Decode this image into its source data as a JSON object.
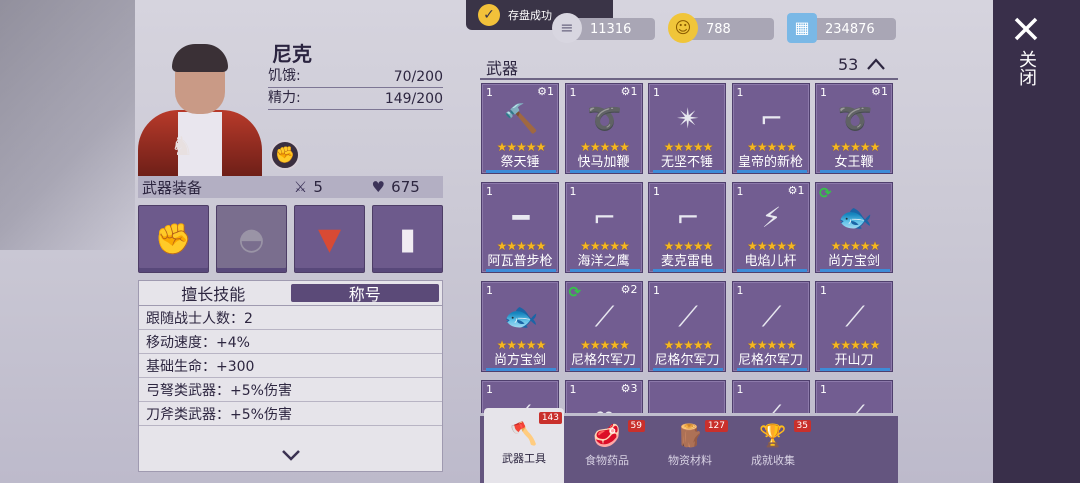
{
  "toast": {
    "text": "存盘成功"
  },
  "currencies": [
    {
      "icon": "coin-stack-icon",
      "value": "11316"
    },
    {
      "icon": "smiley-coin-icon",
      "value": "788"
    },
    {
      "icon": "map-ticket-icon",
      "value": "234876"
    }
  ],
  "character": {
    "name": "尼克",
    "stats": [
      {
        "label": "饥饿:",
        "value": "70/200"
      },
      {
        "label": "精力:",
        "value": "149/200"
      }
    ]
  },
  "equipment": {
    "title": "武器装备",
    "attack": "5",
    "health": "675",
    "slots": [
      {
        "name": "fist-slot",
        "icon": "fist-icon"
      },
      {
        "name": "cap-slot",
        "icon": "cap-icon"
      },
      {
        "name": "coat-slot",
        "icon": "coat-icon"
      },
      {
        "name": "pants-slot",
        "icon": "pants-icon"
      }
    ]
  },
  "skills": {
    "tabs": [
      "擅长技能",
      "称号"
    ],
    "lines": [
      "跟随战士人数：2",
      "移动速度：+4%",
      "基础生命：+300",
      "弓弩类武器：+5%伤害",
      "刀斧类武器：+5%伤害"
    ]
  },
  "inventory": {
    "title": "武器",
    "count": "53",
    "items": [
      {
        "qty": "1",
        "gear": "1",
        "name": "祭天锤",
        "icon": "hammer-icon",
        "stars": 5
      },
      {
        "qty": "1",
        "gear": "1",
        "name": "快马加鞭",
        "icon": "whip-icon",
        "stars": 5
      },
      {
        "qty": "1",
        "gear": "",
        "name": "无坚不锤",
        "icon": "spiked-mace-icon",
        "stars": 5
      },
      {
        "qty": "1",
        "gear": "",
        "name": "皇帝的新枪",
        "icon": "pistol-icon",
        "stars": 5
      },
      {
        "qty": "1",
        "gear": "1",
        "name": "女王鞭",
        "icon": "whip-icon",
        "stars": 5
      },
      {
        "qty": "1",
        "gear": "",
        "name": "阿瓦普步枪",
        "icon": "rifle-icon",
        "stars": 5
      },
      {
        "qty": "1",
        "gear": "",
        "name": "海洋之鹰",
        "icon": "pistol-icon",
        "stars": 5
      },
      {
        "qty": "1",
        "gear": "",
        "name": "麦克雷电",
        "icon": "revolver-icon",
        "stars": 5
      },
      {
        "qty": "1",
        "gear": "1",
        "name": "电焰儿杆",
        "icon": "blaster-icon",
        "stars": 5
      },
      {
        "qty": "",
        "gear": "",
        "refresh": true,
        "name": "尚方宝剑",
        "icon": "fish-sword-icon",
        "stars": 5
      },
      {
        "qty": "1",
        "gear": "",
        "name": "尚方宝剑",
        "icon": "fish-sword-icon",
        "stars": 5
      },
      {
        "qty": "",
        "gear": "2",
        "refresh": true,
        "name": "尼格尔军刀",
        "icon": "kukri-icon",
        "stars": 5
      },
      {
        "qty": "1",
        "gear": "",
        "name": "尼格尔军刀",
        "icon": "kukri-icon",
        "stars": 5
      },
      {
        "qty": "1",
        "gear": "",
        "name": "尼格尔军刀",
        "icon": "kukri-icon",
        "stars": 5
      },
      {
        "qty": "1",
        "gear": "",
        "name": "开山刀",
        "icon": "machete-icon",
        "stars": 5
      },
      {
        "qty": "1",
        "gear": "",
        "name": "",
        "icon": "blade-icon",
        "stars": 0
      },
      {
        "qty": "1",
        "gear": "3",
        "name": "",
        "icon": "chain-icon",
        "stars": 0
      },
      {
        "qty": "",
        "gear": "",
        "name": "",
        "icon": "chevron-down-icon",
        "stars": 0
      },
      {
        "qty": "1",
        "gear": "",
        "name": "",
        "icon": "blade-icon",
        "stars": 0
      },
      {
        "qty": "1",
        "gear": "",
        "name": "",
        "icon": "blade-icon",
        "stars": 0
      }
    ]
  },
  "bottom_tabs": [
    {
      "label": "武器工具",
      "badge": "143",
      "icon": "axe-icon"
    },
    {
      "label": "食物药品",
      "badge": "59",
      "icon": "meat-icon"
    },
    {
      "label": "物资材料",
      "badge": "127",
      "icon": "log-icon"
    },
    {
      "label": "成就收集",
      "badge": "35",
      "icon": "trophy-icon"
    }
  ],
  "close": {
    "label": "关闭"
  }
}
